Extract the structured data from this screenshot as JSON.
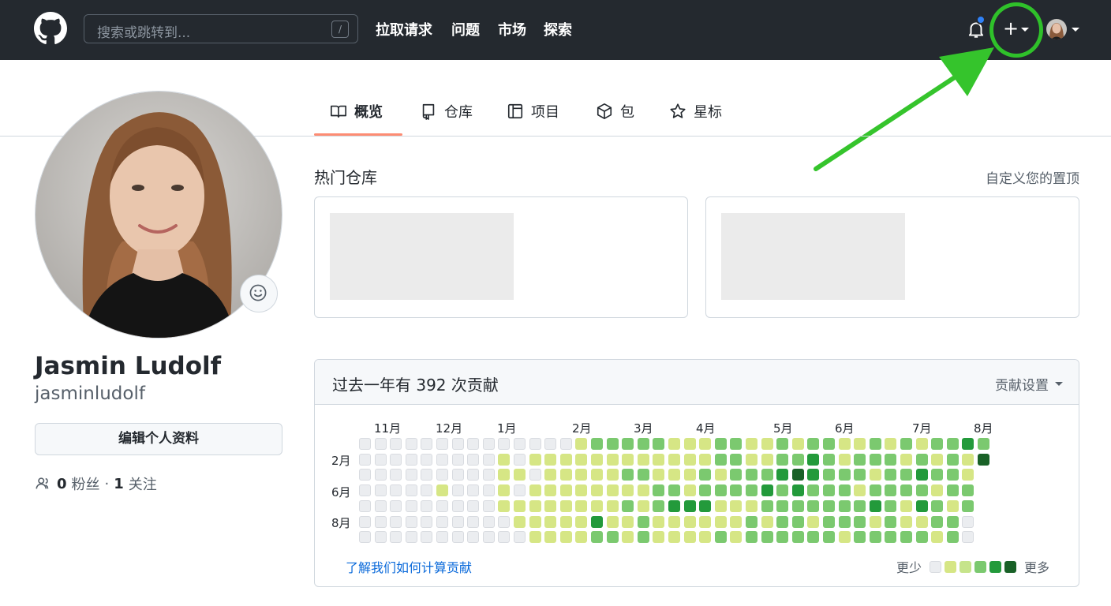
{
  "header": {
    "search_placeholder": "搜索或跳转到...",
    "search_key": "/",
    "nav": [
      "拉取请求",
      "问题",
      "市场",
      "探索"
    ],
    "create_icon": "+",
    "icons": [
      "github-logo-icon",
      "bell-icon",
      "plus-icon",
      "avatar"
    ]
  },
  "tabs": [
    {
      "label": "概览",
      "icon": "book-icon",
      "selected": true
    },
    {
      "label": "仓库",
      "icon": "repo-icon",
      "selected": false
    },
    {
      "label": "项目",
      "icon": "project-icon",
      "selected": false
    },
    {
      "label": "包",
      "icon": "package-icon",
      "selected": false
    },
    {
      "label": "星标",
      "icon": "star-icon",
      "selected": false
    }
  ],
  "profile": {
    "name": "Jasmin Ludolf",
    "login": "jasminludolf",
    "edit_label": "编辑个人资料",
    "followers": "0",
    "followers_label": "粉丝",
    "separator": "·",
    "following": "1",
    "following_label": "关注"
  },
  "popular": {
    "title": "热门仓库",
    "customize": "自定义您的置顶"
  },
  "contributions": {
    "title": "过去一年有 392 次贡献",
    "settings": "贡献设置",
    "months": [
      "11月",
      "12月",
      "1月",
      "2月",
      "3月",
      "4月",
      "5月",
      "6月",
      "7月",
      "8月"
    ],
    "weekdays": [
      "2月",
      "6月",
      "8月"
    ],
    "learn_link": "了解我们如何计算贡献",
    "legend_less": "更少",
    "legend_more": "更多",
    "colors": [
      "#ebedf0",
      "#d6e685",
      "#c6e48b",
      "#7bc96f",
      "#239a3b",
      "#196127"
    ],
    "grid": [
      [
        0,
        0,
        0,
        0,
        0,
        0,
        0,
        0,
        0,
        0,
        0,
        0,
        0,
        0,
        1,
        3,
        3,
        3,
        3,
        3,
        1,
        1,
        1,
        3,
        3,
        1,
        1,
        3,
        1,
        3,
        3,
        1,
        1,
        3,
        1,
        3,
        1,
        3,
        3,
        4,
        3
      ],
      [
        0,
        0,
        0,
        0,
        0,
        0,
        0,
        0,
        0,
        1,
        0,
        1,
        1,
        1,
        1,
        1,
        1,
        1,
        1,
        1,
        1,
        1,
        1,
        3,
        3,
        1,
        1,
        3,
        3,
        4,
        3,
        1,
        3,
        3,
        3,
        1,
        3,
        1,
        3,
        1,
        5
      ],
      [
        0,
        0,
        0,
        0,
        0,
        0,
        0,
        0,
        0,
        1,
        1,
        0,
        1,
        1,
        1,
        1,
        1,
        3,
        3,
        1,
        1,
        1,
        3,
        1,
        3,
        3,
        3,
        4,
        5,
        4,
        3,
        3,
        3,
        1,
        3,
        3,
        4,
        3,
        3,
        1
      ],
      [
        0,
        0,
        0,
        0,
        0,
        1,
        0,
        0,
        0,
        1,
        0,
        1,
        1,
        1,
        1,
        1,
        1,
        1,
        1,
        3,
        3,
        1,
        3,
        3,
        3,
        3,
        4,
        3,
        4,
        3,
        3,
        3,
        1,
        3,
        3,
        3,
        3,
        1,
        3,
        3
      ],
      [
        0,
        0,
        0,
        0,
        0,
        0,
        0,
        0,
        0,
        1,
        1,
        1,
        1,
        1,
        1,
        1,
        1,
        3,
        1,
        3,
        4,
        4,
        4,
        1,
        1,
        1,
        3,
        3,
        3,
        3,
        3,
        3,
        3,
        4,
        3,
        1,
        4,
        3,
        1,
        3
      ],
      [
        0,
        0,
        0,
        0,
        0,
        0,
        0,
        0,
        0,
        0,
        1,
        1,
        1,
        1,
        1,
        4,
        1,
        1,
        3,
        1,
        1,
        1,
        1,
        1,
        1,
        3,
        1,
        3,
        3,
        1,
        3,
        3,
        3,
        1,
        3,
        1,
        1,
        3,
        3,
        0
      ],
      [
        0,
        0,
        0,
        0,
        0,
        0,
        0,
        0,
        0,
        0,
        0,
        1,
        1,
        1,
        1,
        3,
        3,
        1,
        3,
        1,
        1,
        1,
        1,
        3,
        1,
        3,
        3,
        3,
        3,
        3,
        3,
        1,
        3,
        3,
        3,
        3,
        3,
        1,
        3,
        0
      ]
    ]
  }
}
